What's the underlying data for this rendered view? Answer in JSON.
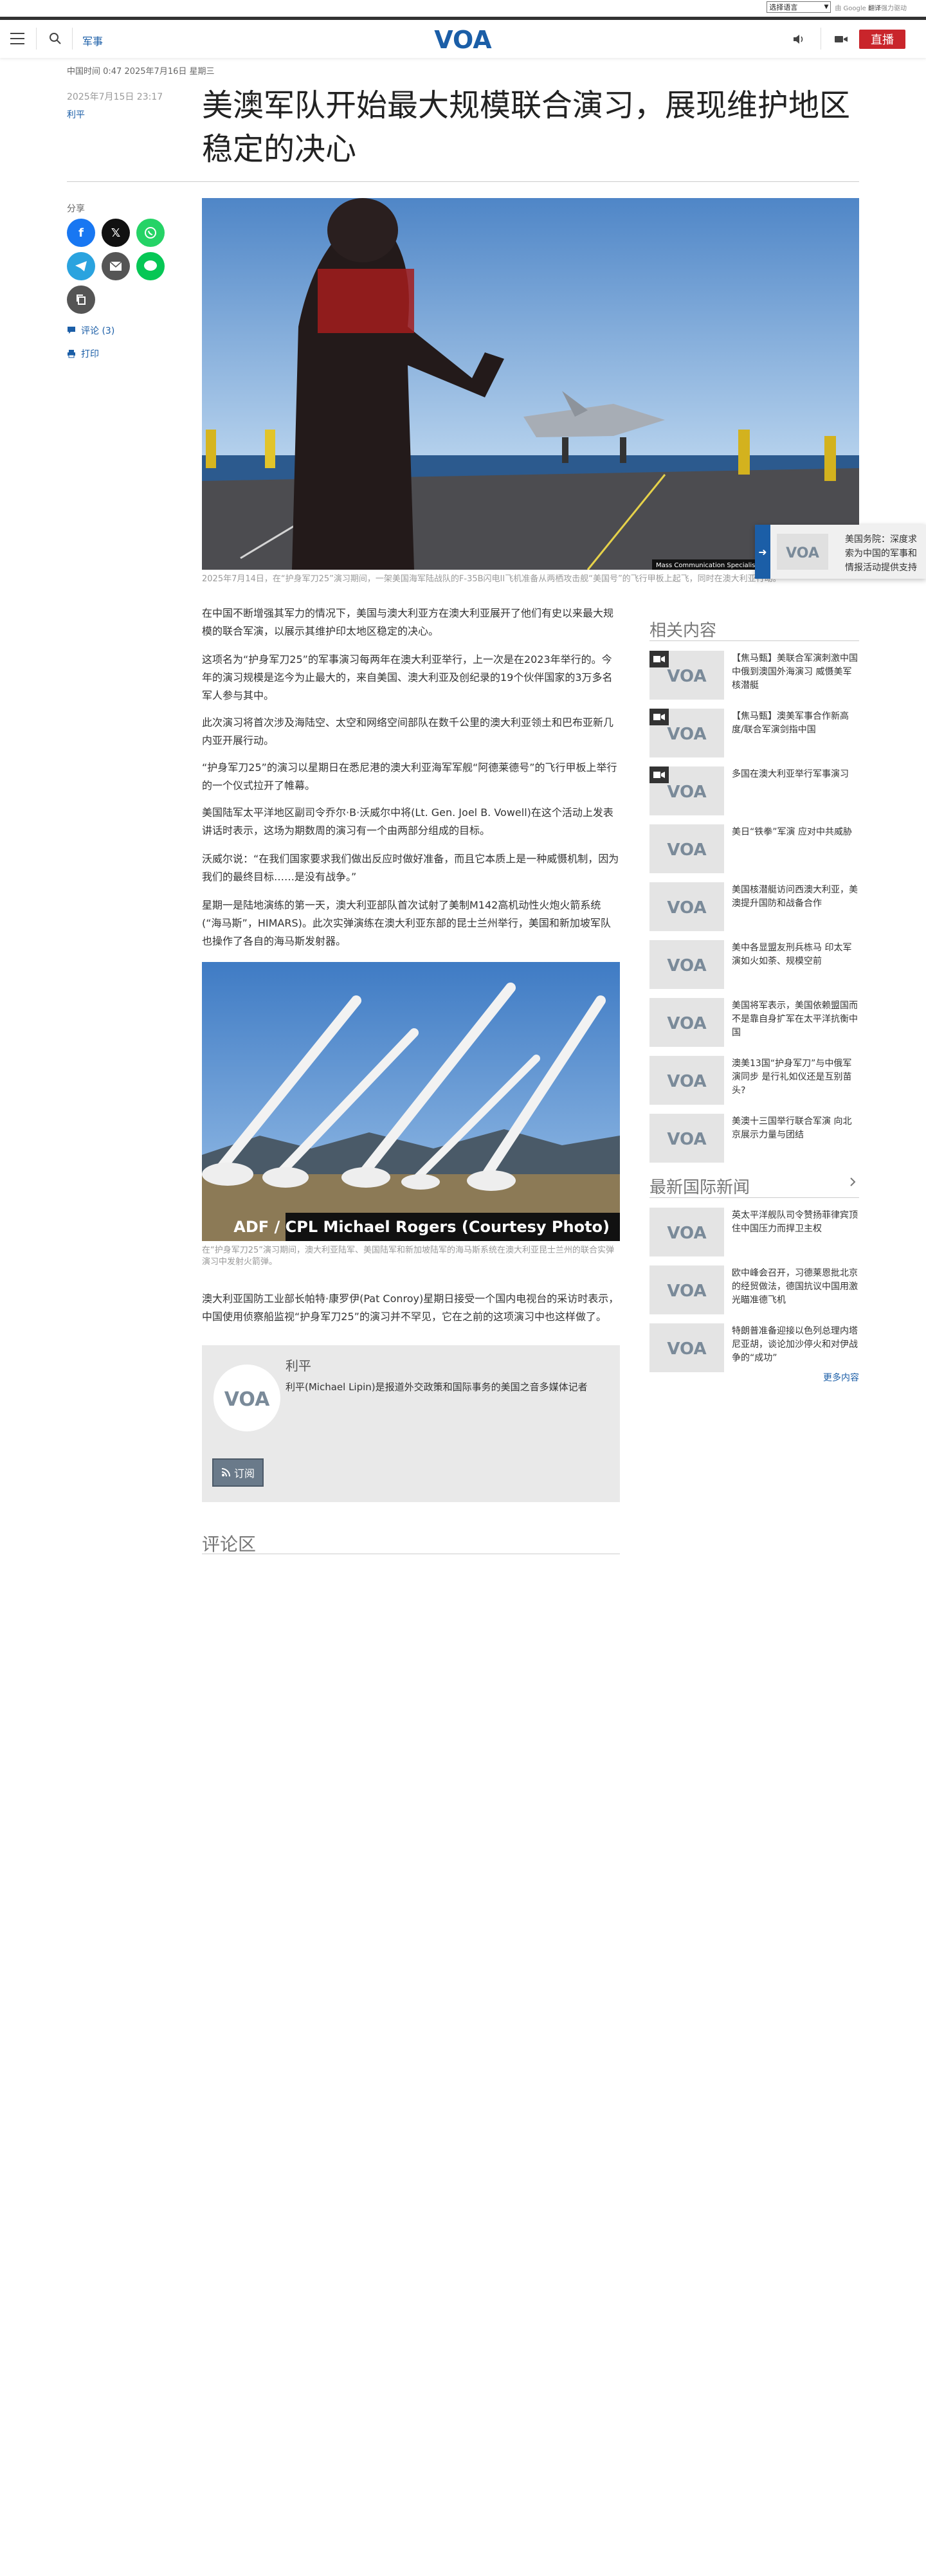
{
  "translate": {
    "select_label": "选择语言",
    "powered": "由",
    "google": "Google",
    "translate_word": "翻译",
    "support": "强力驱动"
  },
  "header": {
    "section": "军事",
    "live": "直播",
    "logo_text": "VOA"
  },
  "meta": {
    "time_line": "中国时间 0:47 2025年7月16日 星期三",
    "pub_date": "2025年7月15日 23:17",
    "author": "利平"
  },
  "article": {
    "title": "美澳军队开始最大规模联合演习，展现维护地区稳定的决心",
    "hero_caption": "2025年7月14日，在“护身军刀25”演习期间，一架美国海军陆战队的F-35B闪电II飞机准备从两栖攻击舰“美国号”的飞行甲板上起飞，同时在澳大利亚行动。",
    "hero_credit": "Mass Communication Specialist 3rd",
    "paragraphs": [
      "在中国不断增强其军力的情况下，美国与澳大利亚方在澳大利亚展开了他们有史以来最大规模的联合军演，以展示其维护印太地区稳定的决心。",
      "这项名为“护身军刀25”的军事演习每两年在澳大利亚举行，上一次是在2023年举行的。今年的演习规模是迄今为止最大的，来自美国、澳大利亚及创纪录的19个伙伴国家的3万多名军人参与其中。",
      "此次演习将首次涉及海陆空、太空和网络空间部队在数千公里的澳大利亚领土和巴布亚新几内亚开展行动。",
      "“护身军刀25”的演习以星期日在悉尼港的澳大利亚海军军舰“阿德莱德号”的飞行甲板上举行的一个仪式拉开了帷幕。",
      "美国陆军太平洋地区副司令乔尔·B·沃威尔中将(Lt. Gen. Joel B. Vowell)在这个活动上发表讲话时表示，这场为期数周的演习有一个由两部分组成的目标。",
      "沃威尔说：“在我们国家要求我们做出反应时做好准备，而且它本质上是一种威慑机制，因为我们的最终目标……是没有战争。”",
      "星期一是陆地演练的第一天，澳大利亚部队首次试射了美制M142高机动性火炮火箭系统(“海马斯”，HIMARS)。此次实弹演练在澳大利亚东部的昆士兰州举行，美国和新加坡军队也操作了各自的海马斯发射器。"
    ],
    "img2_caption": "在“护身军刀25”演习期间，澳大利亚陆军、美国陆军和新加坡陆军的海马斯系统在澳大利亚昆士兰州的联合实弹演习中发射火箭弹。",
    "img2_credit": "ADF / CPL Michael Rogers (Courtesy Photo)",
    "closing": "澳大利亚国防工业部长帕特·康罗伊(Pat Conroy)星期日接受一个国内电视台的采访时表示，中国使用侦察船监视“护身军刀25”的演习并不罕见，它在之前的这项演习中也这样做了。"
  },
  "share": {
    "label": "分享",
    "comments": "评论 (3)",
    "print": "打印"
  },
  "author_box": {
    "name": "利平",
    "bio": "利平(Michael Lipin)是报道外交政策和国际事务的美国之音多媒体记者",
    "subscribe": "订阅"
  },
  "comments_title": "评论区",
  "related": {
    "title": "相关内容",
    "items": [
      {
        "text": "【焦马甄】美联合军演刺激中国中俄到澳国外海演习 威慑美军核潜艇",
        "video": true
      },
      {
        "text": "【焦马甄】澳美军事合作新高度/联合军演剑指中国",
        "video": true
      },
      {
        "text": "多国在澳大利亚举行军事演习",
        "video": true
      },
      {
        "text": "美日“铁拳”军演 应对中共威胁",
        "video": false
      },
      {
        "text": "美国核潜艇访问西澳大利亚，美澳提升国防和战备合作",
        "video": false
      },
      {
        "text": "美中各显盟友刑兵栋马 印太军演如火如荼、规模空前",
        "video": false
      },
      {
        "text": "美国将军表示，美国依赖盟国而不是靠自身扩军在太平洋抗衡中国",
        "video": false
      },
      {
        "text": "澳美13国“护身军刀”与中俄军演同步 是行礼如仪还是互别苗头?",
        "video": false
      },
      {
        "text": "美澳十三国举行联合军演 向北京展示力量与团结",
        "video": false
      }
    ]
  },
  "latest": {
    "title": "最新国际新闻",
    "items": [
      {
        "text": "英太平洋舰队司令赞扬菲律宾顶住中国压力而捍卫主权"
      },
      {
        "text": "欧中峰会召开，习德莱恩批北京的经贸做法，德国抗议中国用激光瞄准德飞机"
      },
      {
        "text": "特朗普准备迎接以色列总理内塔尼亚胡，谈论加沙停火和对伊战争的“成功”"
      }
    ],
    "more": "更多内容"
  },
  "floating": {
    "text": "美国务院：深度求索为中国的军事和情报活动提供支持"
  }
}
